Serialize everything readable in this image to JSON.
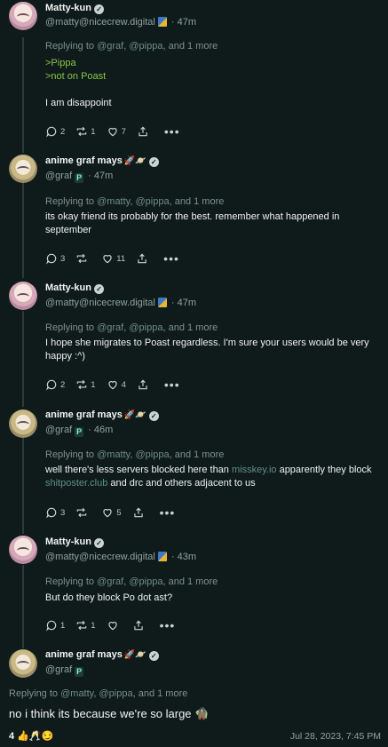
{
  "posts": [
    {
      "name": "Matty-kun",
      "handle": "@matty@nicecrew.digital",
      "time": "47m",
      "replying_prefix": "Replying to",
      "mentions": [
        "@graf",
        "@pippa"
      ],
      "and_more": "and 1 more",
      "greentext": [
        ">Pippa",
        ">not on Poast"
      ],
      "text": "I am disappoint",
      "replies": "2",
      "reposts": "1",
      "likes": "7"
    },
    {
      "name": "anime graf mays",
      "handle": "@graf",
      "time": "47m",
      "replying_prefix": "Replying to",
      "mentions": [
        "@matty",
        "@pippa"
      ],
      "and_more": "and 1 more",
      "text": "its okay friend its probably for the best. remember what happened in september",
      "replies": "3",
      "reposts": "",
      "likes": "11"
    },
    {
      "name": "Matty-kun",
      "handle": "@matty@nicecrew.digital",
      "time": "47m",
      "replying_prefix": "Replying to",
      "mentions": [
        "@graf",
        "@pippa"
      ],
      "and_more": "and 1 more",
      "text": "I hope she migrates to Poast regardless. I'm sure your users would be very happy :^)",
      "replies": "2",
      "reposts": "1",
      "likes": "4"
    },
    {
      "name": "anime graf mays",
      "handle": "@graf",
      "time": "46m",
      "replying_prefix": "Replying to",
      "mentions": [
        "@matty",
        "@pippa"
      ],
      "and_more": "and 1 more",
      "text_parts": [
        "well there's less servers blocked here than ",
        "misskey.io",
        " apparently they block ",
        "shitposter.club",
        " and drc and others adjacent to us"
      ],
      "replies": "3",
      "reposts": "",
      "likes": "5"
    },
    {
      "name": "Matty-kun",
      "handle": "@matty@nicecrew.digital",
      "time": "43m",
      "replying_prefix": "Replying to",
      "mentions": [
        "@graf",
        "@pippa"
      ],
      "and_more": "and 1 more",
      "text": "But do they block Po dot ast?",
      "replies": "1",
      "reposts": "1",
      "likes": ""
    }
  ],
  "focus": {
    "name": "anime graf mays",
    "handle": "@graf",
    "replying_prefix": "Replying to",
    "mentions": [
      "@matty",
      "@pippa"
    ],
    "and_more": "and 1 more",
    "text": "no i think its because we're so large",
    "reaction_count": "4",
    "reactions": "👍🥂😏",
    "date": "Jul 28, 2023, 7:45 PM"
  },
  "icons": [
    "verified-icon",
    "reply-icon",
    "repost-icon",
    "like-icon",
    "share-icon",
    "more-icon"
  ],
  "colors": {
    "background": "#0f1b1a",
    "greentext": "#8bc34a",
    "mention": "#6f8c88"
  }
}
